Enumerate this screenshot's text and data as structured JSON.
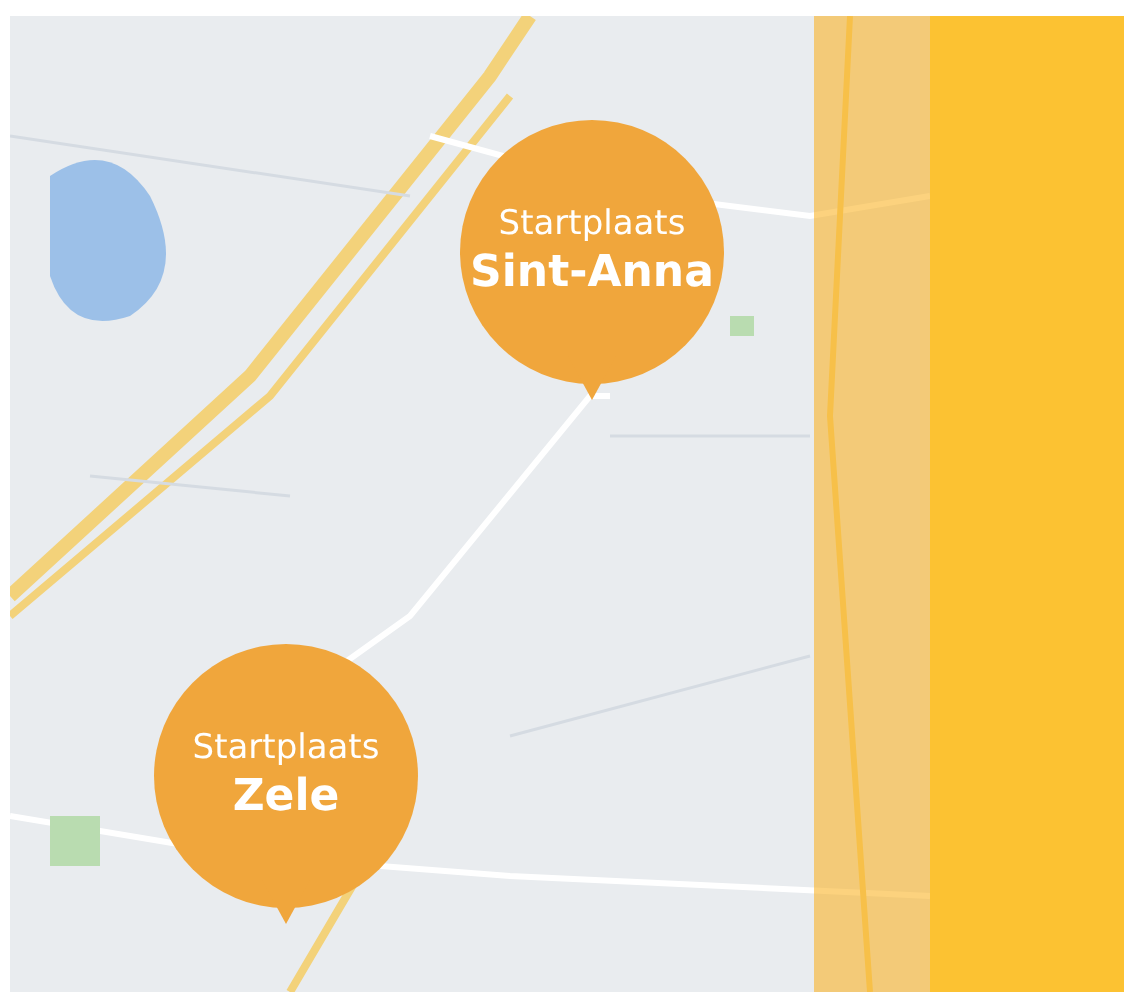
{
  "pins": [
    {
      "label": "Startplaats",
      "place": "Sint-Anna"
    },
    {
      "label": "Startplaats",
      "place": "Zele"
    }
  ]
}
